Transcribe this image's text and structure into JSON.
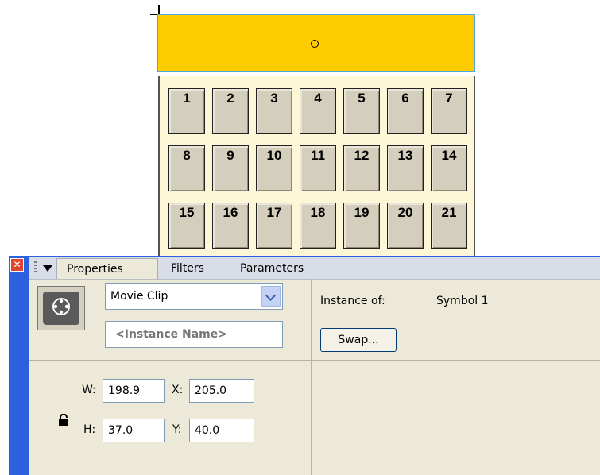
{
  "stage": {
    "bar_color": "#ffcc00",
    "calendar_days": [
      "1",
      "2",
      "3",
      "4",
      "5",
      "6",
      "7",
      "8",
      "9",
      "10",
      "11",
      "12",
      "13",
      "14",
      "15",
      "16",
      "17",
      "18",
      "19",
      "20",
      "21"
    ]
  },
  "panel": {
    "tabs": [
      "Properties",
      "Filters",
      "Parameters"
    ],
    "symbol_type": "Movie Clip",
    "instance_name_placeholder": "<Instance Name>",
    "instance_of_label": "Instance of:",
    "symbol_name": "Symbol 1",
    "swap_button": "Swap...",
    "w_label": "W:",
    "w_value": "198.9",
    "h_label": "H:",
    "h_value": "37.0",
    "x_label": "X:",
    "x_value": "205.0",
    "y_label": "Y:",
    "y_value": "40.0"
  },
  "icons": {
    "close": "close-icon",
    "panel_menu": "menu-arrow-icon",
    "symbol": "movie-clip-icon",
    "lock": "lock-icon"
  },
  "colors": {
    "panel_border": "#2b60de",
    "panel_bg": "#ece9d8",
    "calendar_bg": "#fdf7d7",
    "cell_bg": "#d4cfbd"
  }
}
